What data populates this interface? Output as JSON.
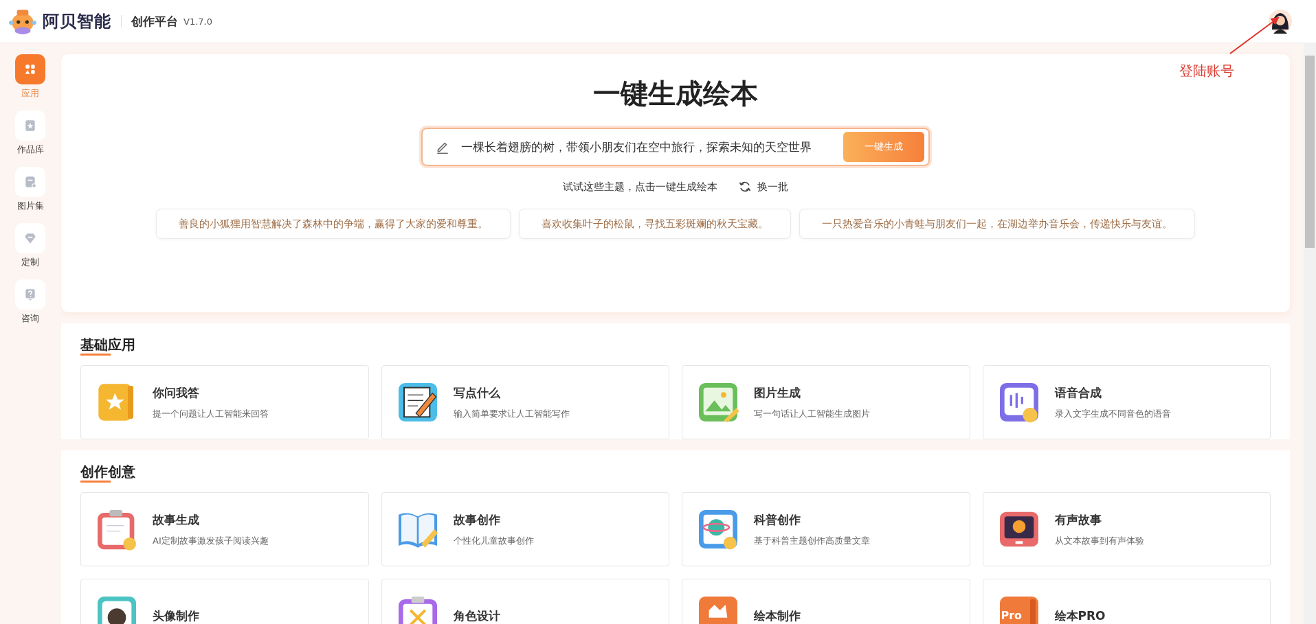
{
  "header": {
    "brand": "阿贝智能",
    "product": "创作平台",
    "version": "V1.7.0"
  },
  "annotation": {
    "text": "登陆账号"
  },
  "sidebar": {
    "items": [
      {
        "label": "应用",
        "selected": true
      },
      {
        "label": "作品库",
        "selected": false
      },
      {
        "label": "图片集",
        "selected": false
      },
      {
        "label": "定制",
        "selected": false
      },
      {
        "label": "咨询",
        "selected": false
      }
    ]
  },
  "hero": {
    "title": "一键生成绘本",
    "input": {
      "value": "一棵长着翅膀的树，带领小朋友们在空中旅行，探索未知的天空世界"
    },
    "button": "一键生成",
    "hint": "试试这些主题，点击一键生成绘本",
    "refresh": "换一批",
    "suggestions": [
      "善良的小狐狸用智慧解决了森林中的争端，赢得了大家的爱和尊重。",
      "喜欢收集叶子的松鼠，寻找五彩斑斓的秋天宝藏。",
      "一只热爱音乐的小青蛙与朋友们一起，在湖边举办音乐会，传递快乐与友谊。"
    ]
  },
  "sections": [
    {
      "title": "基础应用",
      "apps": [
        {
          "title": "你问我答",
          "desc": "提一个问题让人工智能来回答"
        },
        {
          "title": "写点什么",
          "desc": "输入简单要求让人工智能写作"
        },
        {
          "title": "图片生成",
          "desc": "写一句话让人工智能生成图片"
        },
        {
          "title": "语音合成",
          "desc": "录入文字生成不同音色的语音"
        }
      ]
    },
    {
      "title": "创作创意",
      "apps": [
        {
          "title": "故事生成",
          "desc": "AI定制故事激发孩子阅读兴趣"
        },
        {
          "title": "故事创作",
          "desc": "个性化儿童故事创作"
        },
        {
          "title": "科普创作",
          "desc": "基于科普主题创作高质量文章"
        },
        {
          "title": "有声故事",
          "desc": "从文本故事到有声体验"
        },
        {
          "title": "头像制作"
        },
        {
          "title": "角色设计"
        },
        {
          "title": "绘本制作"
        },
        {
          "title": "绘本PRO",
          "badge": "Pro"
        }
      ]
    }
  ]
}
